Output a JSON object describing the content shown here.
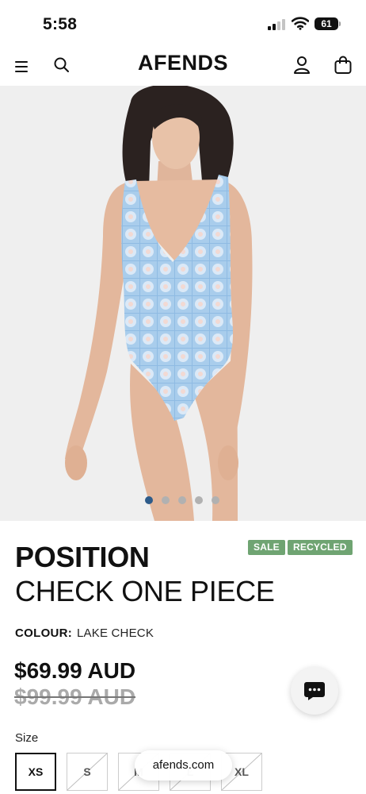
{
  "status_bar": {
    "time": "5:58",
    "battery": "61",
    "icons": [
      "signal-icon",
      "wifi-icon",
      "battery-icon"
    ]
  },
  "header": {
    "brand": "AFENDS",
    "icons": [
      "menu-icon",
      "search-icon",
      "account-icon",
      "bag-icon"
    ]
  },
  "gallery": {
    "image_count": 5,
    "active_index": 0,
    "colors": {
      "active_dot": "#2d5b8a",
      "inactive_dot": "#b1b1b1"
    }
  },
  "product": {
    "badges": [
      "SALE",
      "RECYCLED"
    ],
    "name_line1": "POSITION",
    "name_line2": "CHECK ONE PIECE",
    "colour_label": "COLOUR:",
    "colour_value": "LAKE CHECK",
    "price_current": "$69.99 AUD",
    "price_original": "$99.99 AUD",
    "badge_color": "#6fa472"
  },
  "size_selector": {
    "label": "Size",
    "options": [
      {
        "label": "XS",
        "selected": true,
        "available": true
      },
      {
        "label": "S",
        "selected": false,
        "available": false
      },
      {
        "label": "M",
        "selected": false,
        "available": false
      },
      {
        "label": "L",
        "selected": false,
        "available": false
      },
      {
        "label": "XL",
        "selected": false,
        "available": false
      }
    ]
  },
  "browser": {
    "url": "afends.com"
  },
  "chat": {
    "icon": "chat-icon"
  }
}
